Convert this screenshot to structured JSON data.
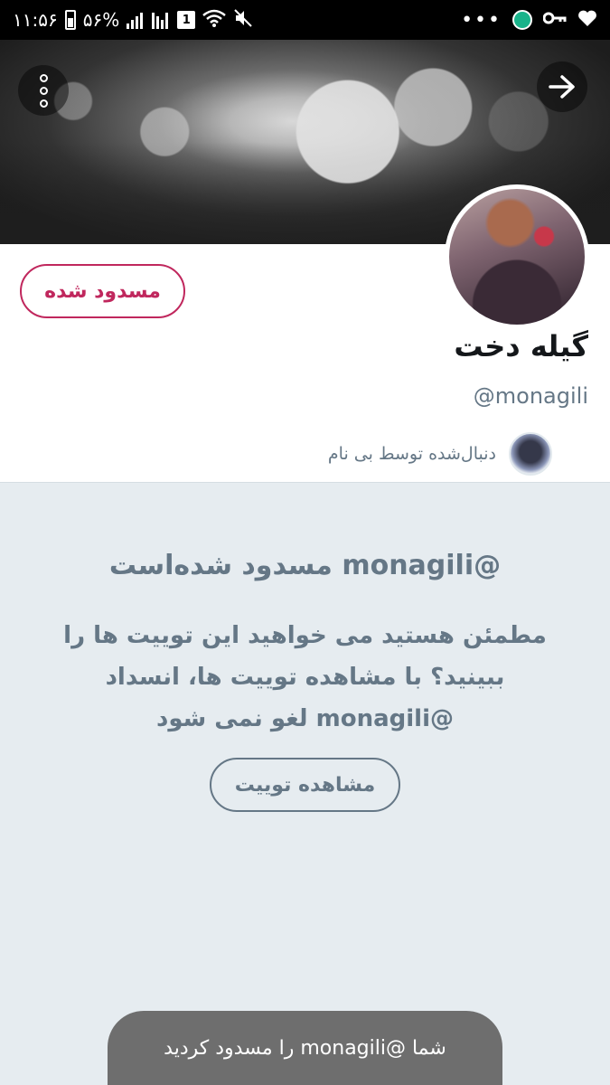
{
  "status_bar": {
    "time": "۱۱:۵۶",
    "battery": "۵۶%",
    "sim": "1",
    "more": "•••",
    "icons": [
      "battery-icon",
      "signal-icon",
      "sim-icon",
      "wifi-icon",
      "mute-icon",
      "shield-icon",
      "key-icon",
      "heart-icon"
    ]
  },
  "header": {
    "menu_icon": "more-vertical-icon",
    "next_icon": "arrow-right-icon"
  },
  "profile": {
    "blocked_button_label": "مسدود شده",
    "display_name": "گیله دخت",
    "handle": "@monagili",
    "followed_by_text": "دنبال‌شده توسط بی نام"
  },
  "blocked_notice": {
    "title": "@monagili مسدود شده‌است",
    "body": "مطمئن هستید می خواهید این توییت ها را ببینید؟ با مشاهده توییت ها، انسداد @monagili لغو نمی شود",
    "view_button_label": "مشاهده توییت"
  },
  "toast": {
    "message": "شما @monagili را مسدود کردید"
  },
  "colors": {
    "accent_red": "#c0275d",
    "muted_gray": "#657786",
    "background": "#e6ecf0"
  }
}
